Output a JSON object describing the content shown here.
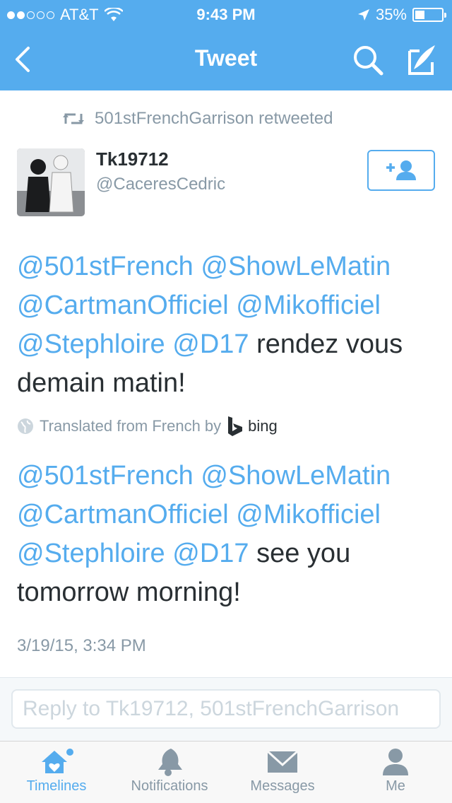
{
  "status_bar": {
    "carrier": "AT&T",
    "time": "9:43 PM",
    "battery": "35%",
    "battery_level": 0.35
  },
  "nav": {
    "title": "Tweet"
  },
  "retweet": {
    "text": "501stFrenchGarrison retweeted"
  },
  "author": {
    "name": "Tk19712",
    "handle": "@CaceresCedric"
  },
  "tweet": {
    "original": {
      "mention_1": "@501stFrench",
      "mention_2": "@ShowLeMatin",
      "mention_3": "@CartmanOfficiel",
      "mention_4": "@Mikofficiel",
      "mention_5": "@Stephloire",
      "mention_6": "@D17",
      "text_1": "rendez vous",
      "text_2": "demain matin!"
    },
    "translation_label": "Translated from French by",
    "translator": "bing",
    "translated": {
      "mention_1": "@501stFrench",
      "mention_2": "@ShowLeMatin",
      "mention_3": "@CartmanOfficiel",
      "mention_4": "@Mikofficiel",
      "mention_5": "@Stephloire",
      "mention_6": "@D17",
      "text_1": "see you",
      "text_2": "tomorrow morning!"
    },
    "timestamp": "3/19/15, 3:34 PM"
  },
  "reply": {
    "placeholder": "Reply to Tk19712, 501stFrenchGarrison"
  },
  "tabs": [
    {
      "label": "Timelines",
      "icon": "home-icon"
    },
    {
      "label": "Notifications",
      "icon": "bell-icon"
    },
    {
      "label": "Messages",
      "icon": "envelope-icon"
    },
    {
      "label": "Me",
      "icon": "person-icon"
    }
  ],
  "colors": {
    "accent": "#55acee",
    "text": "#292f33",
    "secondary": "#8899a6"
  }
}
